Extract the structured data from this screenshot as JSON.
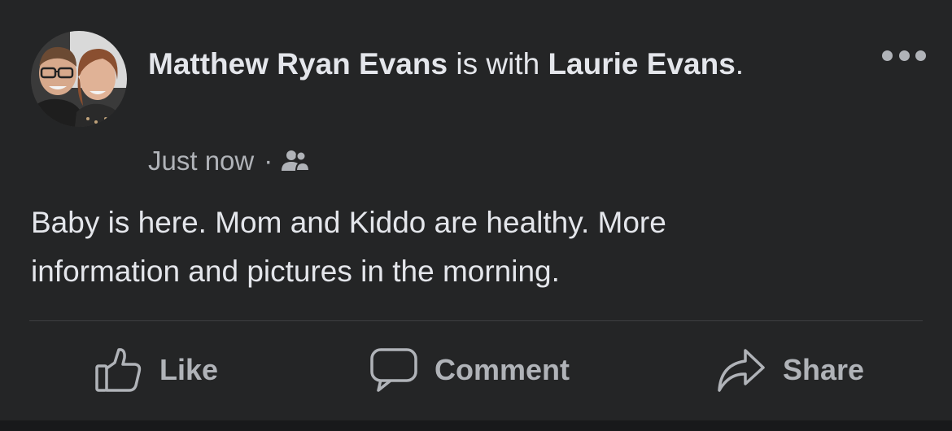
{
  "post": {
    "author": "Matthew Ryan Evans",
    "with_text": "is with",
    "tagged_person": "Laurie Evans",
    "period": ".",
    "timestamp": "Just now",
    "separator": "·",
    "audience_icon": "friends-icon",
    "body_line1": "Baby is here. Mom and Kiddo are healthy. More",
    "body_line2": "information and pictures in the morning."
  },
  "actions": {
    "like_label": "Like",
    "comment_label": "Comment",
    "share_label": "Share"
  },
  "colors": {
    "background": "#242526",
    "primary_text": "#e4e6eb",
    "secondary_text": "#b0b3b8",
    "divider": "#3e4042"
  }
}
